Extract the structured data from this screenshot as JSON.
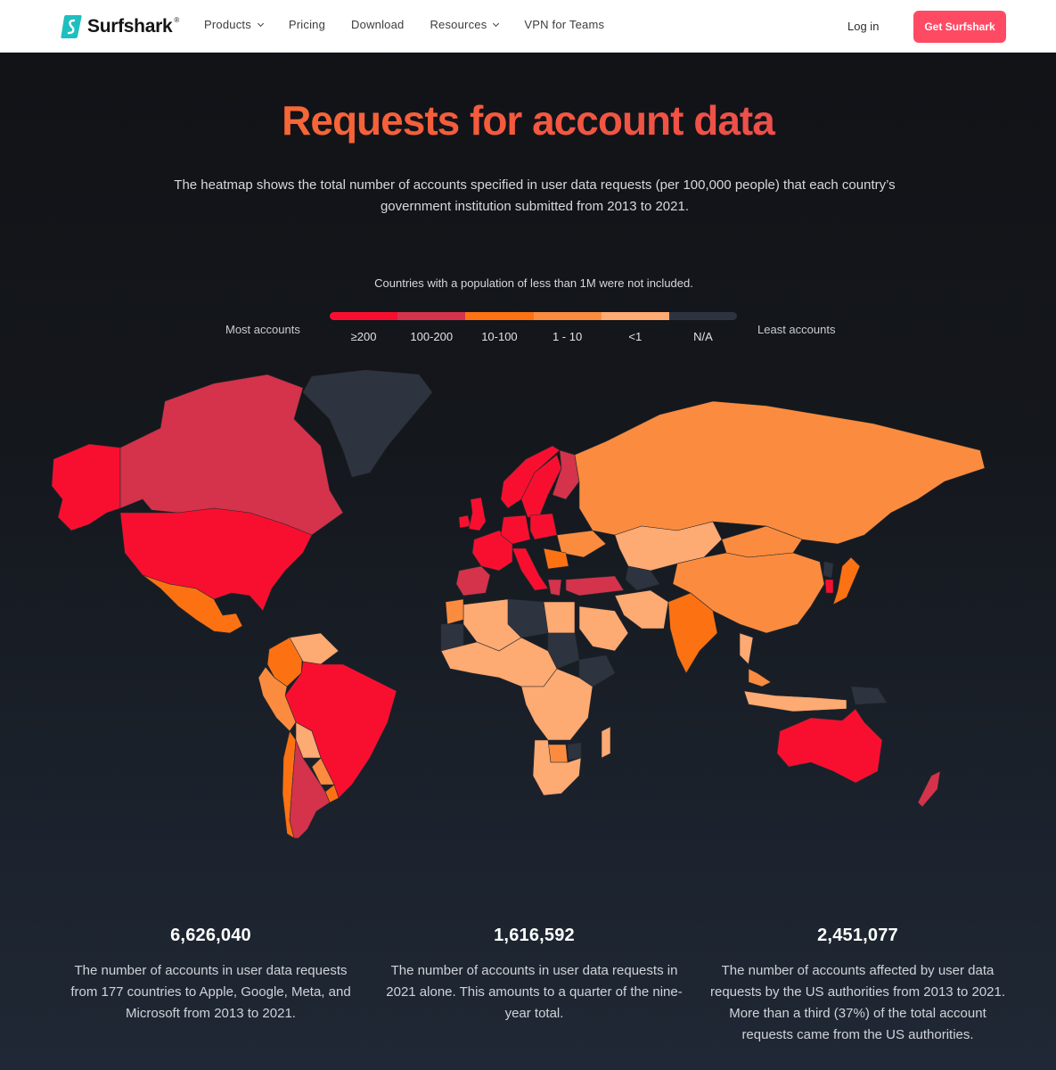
{
  "nav": {
    "brand": "Surfshark",
    "brand_mark": "®",
    "links": [
      {
        "label": "Products",
        "has_dropdown": true
      },
      {
        "label": "Pricing",
        "has_dropdown": false
      },
      {
        "label": "Download",
        "has_dropdown": false
      },
      {
        "label": "Resources",
        "has_dropdown": true
      },
      {
        "label": "VPN for Teams",
        "has_dropdown": false
      }
    ],
    "login": "Log in",
    "cta": "Get Surfshark",
    "cta_color": "#ff4a64",
    "brand_color": "#1fbfbf"
  },
  "hero": {
    "title": "Requests for account data",
    "subtitle_line1": "The heatmap shows the total number of accounts specified in user data requests (per 100,000 people) that each country’s",
    "subtitle_line2": "government institution submitted from 2013 to 2021.",
    "note": "Countries with a population of less than 1M were not included."
  },
  "legend": {
    "left_label": "Most accounts",
    "right_label": "Least accounts",
    "bins": [
      {
        "label": "≥200",
        "color": "#f80f30"
      },
      {
        "label": "100-200",
        "color": "#d4334b"
      },
      {
        "label": "10-100",
        "color": "#fc7212"
      },
      {
        "label": "1 - 10",
        "color": "#fb8c3f"
      },
      {
        "label": "<1",
        "color": "#fdaa73"
      },
      {
        "label": "N/A",
        "color": "#2d3440"
      }
    ]
  },
  "chart_data": {
    "type": "heatmap",
    "title": "Requests for account data",
    "metric": "Accounts specified in user data requests per 100,000 people, 2013–2021",
    "legend_placement": "top",
    "categories": [
      "≥200",
      "100-200",
      "10-100",
      "1 - 10",
      "<1",
      "N/A"
    ],
    "countries": [
      {
        "name": "United States",
        "bin": "≥200"
      },
      {
        "name": "Alaska (US)",
        "bin": "≥200"
      },
      {
        "name": "Canada",
        "bin": "100-200"
      },
      {
        "name": "Greenland",
        "bin": "N/A"
      },
      {
        "name": "Mexico",
        "bin": "10-100"
      },
      {
        "name": "Brazil",
        "bin": "≥200"
      },
      {
        "name": "Argentina",
        "bin": "100-200"
      },
      {
        "name": "Chile",
        "bin": "10-100"
      },
      {
        "name": "Colombia",
        "bin": "10-100"
      },
      {
        "name": "Peru",
        "bin": "1 - 10"
      },
      {
        "name": "Venezuela",
        "bin": "<1"
      },
      {
        "name": "Bolivia",
        "bin": "<1"
      },
      {
        "name": "Paraguay",
        "bin": "1 - 10"
      },
      {
        "name": "Uruguay",
        "bin": "10-100"
      },
      {
        "name": "United Kingdom",
        "bin": "≥200"
      },
      {
        "name": "Ireland",
        "bin": "≥200"
      },
      {
        "name": "France",
        "bin": "≥200"
      },
      {
        "name": "Germany",
        "bin": "≥200"
      },
      {
        "name": "Italy",
        "bin": "≥200"
      },
      {
        "name": "Norway",
        "bin": "≥200"
      },
      {
        "name": "Sweden",
        "bin": "≥200"
      },
      {
        "name": "Finland",
        "bin": "100-200"
      },
      {
        "name": "Spain",
        "bin": "100-200"
      },
      {
        "name": "Poland",
        "bin": "≥200"
      },
      {
        "name": "Turkey",
        "bin": "100-200"
      },
      {
        "name": "Greece",
        "bin": "100-200"
      },
      {
        "name": "Romania",
        "bin": "10-100"
      },
      {
        "name": "Ukraine",
        "bin": "1 - 10"
      },
      {
        "name": "Russia",
        "bin": "1 - 10"
      },
      {
        "name": "Kazakhstan",
        "bin": "<1"
      },
      {
        "name": "China",
        "bin": "1 - 10"
      },
      {
        "name": "Mongolia",
        "bin": "1 - 10"
      },
      {
        "name": "India",
        "bin": "10-100"
      },
      {
        "name": "Japan",
        "bin": "10-100"
      },
      {
        "name": "South Korea",
        "bin": "≥200"
      },
      {
        "name": "North Korea",
        "bin": "N/A"
      },
      {
        "name": "Turkmenistan",
        "bin": "N/A"
      },
      {
        "name": "Iran",
        "bin": "<1"
      },
      {
        "name": "Saudi Arabia",
        "bin": "<1"
      },
      {
        "name": "Libya",
        "bin": "N/A"
      },
      {
        "name": "Egypt",
        "bin": "<1"
      },
      {
        "name": "Morocco",
        "bin": "1 - 10"
      },
      {
        "name": "Algeria",
        "bin": "<1"
      },
      {
        "name": "Mauritania",
        "bin": "N/A"
      },
      {
        "name": "Sudan",
        "bin": "N/A"
      },
      {
        "name": "Ethiopia",
        "bin": "N/A"
      },
      {
        "name": "South Africa",
        "bin": "<1"
      },
      {
        "name": "Botswana",
        "bin": "1 - 10"
      },
      {
        "name": "Zimbabwe",
        "bin": "N/A"
      },
      {
        "name": "Madagascar",
        "bin": "<1"
      },
      {
        "name": "Australia",
        "bin": "≥200"
      },
      {
        "name": "New Zealand",
        "bin": "100-200"
      },
      {
        "name": "Indonesia",
        "bin": "<1"
      },
      {
        "name": "Papua New Guinea",
        "bin": "N/A"
      },
      {
        "name": "Malaysia",
        "bin": "1 - 10"
      },
      {
        "name": "Thailand",
        "bin": "<1"
      }
    ]
  },
  "stats": [
    {
      "value": "6,626,040",
      "description": "The number of accounts in user data requests from 177 countries to Apple, Google, Meta, and Microsoft from 2013 to 2021."
    },
    {
      "value": "1,616,592",
      "description": "The number of accounts in user data requests in 2021 alone. This amounts to a quarter of the nine-year total."
    },
    {
      "value": "2,451,077",
      "description": "The number of accounts affected by user data requests by the US authorities from 2013 to 2021. More than a third (37%) of the total account requests came from the US authorities."
    }
  ]
}
